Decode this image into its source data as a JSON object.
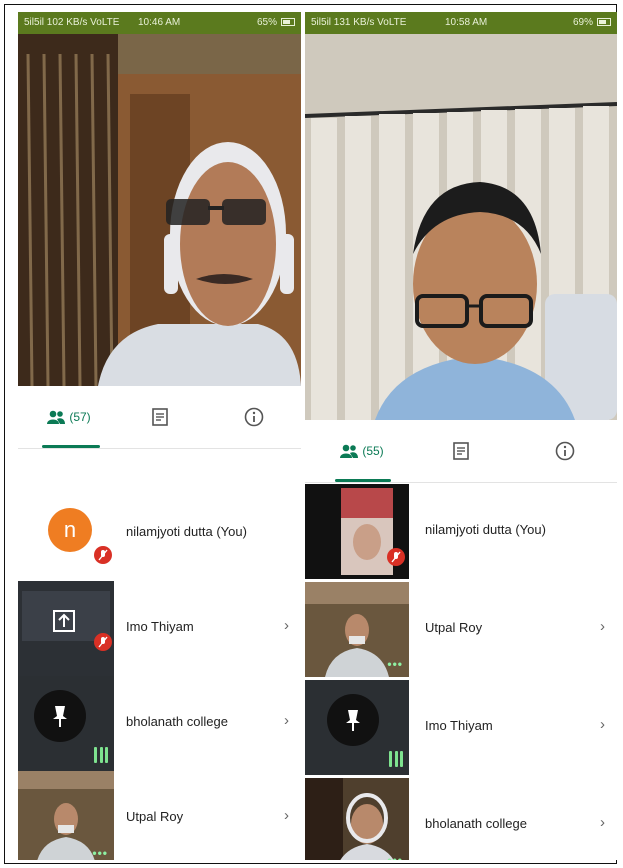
{
  "left": {
    "status": {
      "network": "5il5il 102 KB/s VoLTE",
      "time": "10:46 AM",
      "battery": "65%"
    },
    "tabs": {
      "people_count": "(57)"
    },
    "participants": [
      {
        "name": "nilamjyoti dutta (You)",
        "avatar_letter": "n",
        "has_chevron": false
      },
      {
        "name": "Imo Thiyam",
        "has_chevron": true
      },
      {
        "name": "bholanath college",
        "has_chevron": true
      },
      {
        "name": "Utpal Roy",
        "has_chevron": true
      }
    ]
  },
  "right": {
    "status": {
      "network": "5il5il 131 KB/s VoLTE",
      "time": "10:58 AM",
      "battery": "69%"
    },
    "tabs": {
      "people_count": "(55)"
    },
    "participants": [
      {
        "name": "nilamjyoti dutta (You)",
        "has_chevron": false
      },
      {
        "name": "Utpal Roy",
        "has_chevron": true
      },
      {
        "name": "Imo Thiyam",
        "has_chevron": true
      },
      {
        "name": "bholanath college",
        "has_chevron": true
      }
    ]
  },
  "chevron": "›",
  "icons": [
    "people-icon",
    "chat-icon",
    "info-icon",
    "mic-off-icon",
    "pin-icon",
    "audio-level-icon",
    "more-dots-icon"
  ],
  "colors": {
    "accent": "#0b7a55",
    "avatar": "#ef7d22",
    "mic_off": "#d93025",
    "status_bar": "#5b7a1e"
  }
}
